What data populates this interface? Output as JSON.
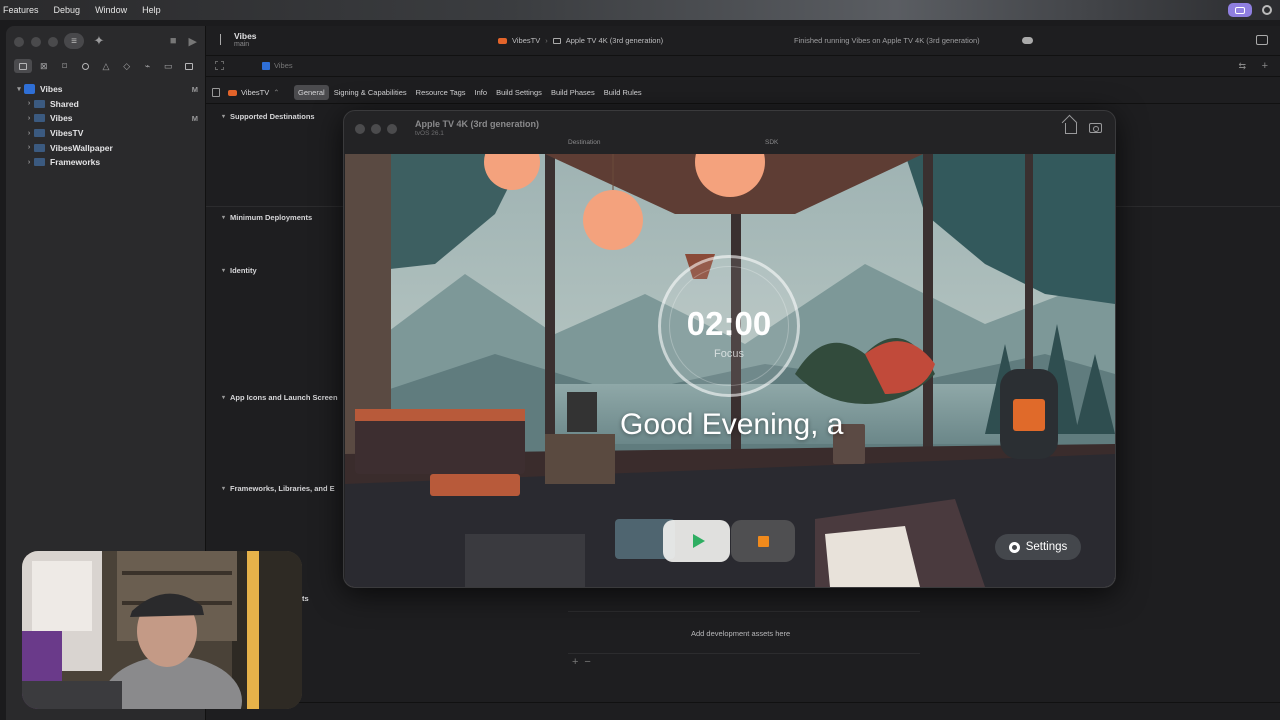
{
  "menubar": {
    "items": [
      "Features",
      "Debug",
      "Window",
      "Help"
    ]
  },
  "xcode": {
    "project_title": "Vibes",
    "branch": "main",
    "scheme": "VibesTV",
    "destination": "Apple TV 4K (3rd generation)",
    "status": "Finished running Vibes on Apple TV 4K (3rd generation)",
    "breadcrumb_file": "Vibes",
    "target": "VibesTV",
    "settings_tabs": [
      "General",
      "Signing & Capabilities",
      "Resource Tags",
      "Info",
      "Build Settings",
      "Build Phases",
      "Build Rules"
    ],
    "sections": {
      "supported": "Supported Destinations",
      "minimum": "Minimum Deployments",
      "identity": "Identity",
      "app_icons": "App Icons and Launch Screen",
      "frameworks": "Frameworks, Libraries, and E",
      "assets_tail": "ts"
    },
    "assets_message": "Add development assets here",
    "peek_destination": "Destination",
    "peek_sdk": "SDK"
  },
  "navigator": {
    "items": [
      {
        "label": "Vibes",
        "badge": "M"
      },
      {
        "label": "Shared",
        "badge": ""
      },
      {
        "label": "Vibes",
        "badge": "M"
      },
      {
        "label": "VibesTV",
        "badge": ""
      },
      {
        "label": "VibesWallpaper",
        "badge": ""
      },
      {
        "label": "Frameworks",
        "badge": ""
      }
    ]
  },
  "simulator": {
    "title": "Apple TV 4K (3rd generation)",
    "os": "tvOS 26.1",
    "timer": "02:00",
    "timer_label": "Focus",
    "greeting": "Good Evening, a",
    "settings_label": "Settings"
  },
  "colors": {
    "accent": "#8f7fe0",
    "play": "#2fae62",
    "stop": "#f08a1c",
    "lamp": "#f4a27d"
  }
}
